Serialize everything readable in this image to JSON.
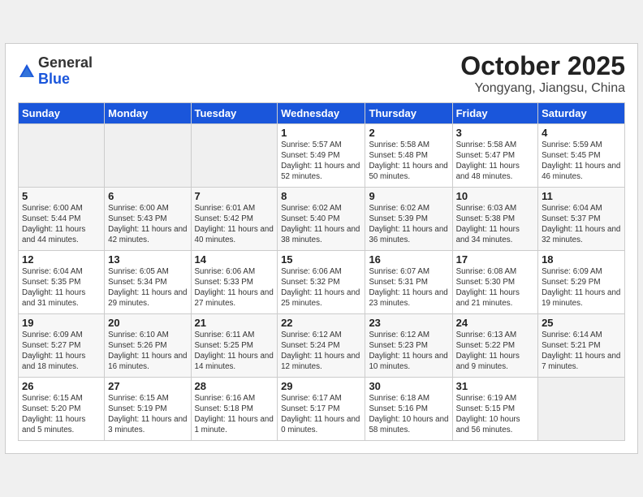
{
  "header": {
    "logo_general": "General",
    "logo_blue": "Blue",
    "title": "October 2025",
    "subtitle": "Yongyang, Jiangsu, China"
  },
  "weekdays": [
    "Sunday",
    "Monday",
    "Tuesday",
    "Wednesday",
    "Thursday",
    "Friday",
    "Saturday"
  ],
  "weeks": [
    [
      {
        "day": "",
        "info": ""
      },
      {
        "day": "",
        "info": ""
      },
      {
        "day": "",
        "info": ""
      },
      {
        "day": "1",
        "info": "Sunrise: 5:57 AM\nSunset: 5:49 PM\nDaylight: 11 hours and 52 minutes."
      },
      {
        "day": "2",
        "info": "Sunrise: 5:58 AM\nSunset: 5:48 PM\nDaylight: 11 hours and 50 minutes."
      },
      {
        "day": "3",
        "info": "Sunrise: 5:58 AM\nSunset: 5:47 PM\nDaylight: 11 hours and 48 minutes."
      },
      {
        "day": "4",
        "info": "Sunrise: 5:59 AM\nSunset: 5:45 PM\nDaylight: 11 hours and 46 minutes."
      }
    ],
    [
      {
        "day": "5",
        "info": "Sunrise: 6:00 AM\nSunset: 5:44 PM\nDaylight: 11 hours and 44 minutes."
      },
      {
        "day": "6",
        "info": "Sunrise: 6:00 AM\nSunset: 5:43 PM\nDaylight: 11 hours and 42 minutes."
      },
      {
        "day": "7",
        "info": "Sunrise: 6:01 AM\nSunset: 5:42 PM\nDaylight: 11 hours and 40 minutes."
      },
      {
        "day": "8",
        "info": "Sunrise: 6:02 AM\nSunset: 5:40 PM\nDaylight: 11 hours and 38 minutes."
      },
      {
        "day": "9",
        "info": "Sunrise: 6:02 AM\nSunset: 5:39 PM\nDaylight: 11 hours and 36 minutes."
      },
      {
        "day": "10",
        "info": "Sunrise: 6:03 AM\nSunset: 5:38 PM\nDaylight: 11 hours and 34 minutes."
      },
      {
        "day": "11",
        "info": "Sunrise: 6:04 AM\nSunset: 5:37 PM\nDaylight: 11 hours and 32 minutes."
      }
    ],
    [
      {
        "day": "12",
        "info": "Sunrise: 6:04 AM\nSunset: 5:35 PM\nDaylight: 11 hours and 31 minutes."
      },
      {
        "day": "13",
        "info": "Sunrise: 6:05 AM\nSunset: 5:34 PM\nDaylight: 11 hours and 29 minutes."
      },
      {
        "day": "14",
        "info": "Sunrise: 6:06 AM\nSunset: 5:33 PM\nDaylight: 11 hours and 27 minutes."
      },
      {
        "day": "15",
        "info": "Sunrise: 6:06 AM\nSunset: 5:32 PM\nDaylight: 11 hours and 25 minutes."
      },
      {
        "day": "16",
        "info": "Sunrise: 6:07 AM\nSunset: 5:31 PM\nDaylight: 11 hours and 23 minutes."
      },
      {
        "day": "17",
        "info": "Sunrise: 6:08 AM\nSunset: 5:30 PM\nDaylight: 11 hours and 21 minutes."
      },
      {
        "day": "18",
        "info": "Sunrise: 6:09 AM\nSunset: 5:29 PM\nDaylight: 11 hours and 19 minutes."
      }
    ],
    [
      {
        "day": "19",
        "info": "Sunrise: 6:09 AM\nSunset: 5:27 PM\nDaylight: 11 hours and 18 minutes."
      },
      {
        "day": "20",
        "info": "Sunrise: 6:10 AM\nSunset: 5:26 PM\nDaylight: 11 hours and 16 minutes."
      },
      {
        "day": "21",
        "info": "Sunrise: 6:11 AM\nSunset: 5:25 PM\nDaylight: 11 hours and 14 minutes."
      },
      {
        "day": "22",
        "info": "Sunrise: 6:12 AM\nSunset: 5:24 PM\nDaylight: 11 hours and 12 minutes."
      },
      {
        "day": "23",
        "info": "Sunrise: 6:12 AM\nSunset: 5:23 PM\nDaylight: 11 hours and 10 minutes."
      },
      {
        "day": "24",
        "info": "Sunrise: 6:13 AM\nSunset: 5:22 PM\nDaylight: 11 hours and 9 minutes."
      },
      {
        "day": "25",
        "info": "Sunrise: 6:14 AM\nSunset: 5:21 PM\nDaylight: 11 hours and 7 minutes."
      }
    ],
    [
      {
        "day": "26",
        "info": "Sunrise: 6:15 AM\nSunset: 5:20 PM\nDaylight: 11 hours and 5 minutes."
      },
      {
        "day": "27",
        "info": "Sunrise: 6:15 AM\nSunset: 5:19 PM\nDaylight: 11 hours and 3 minutes."
      },
      {
        "day": "28",
        "info": "Sunrise: 6:16 AM\nSunset: 5:18 PM\nDaylight: 11 hours and 1 minute."
      },
      {
        "day": "29",
        "info": "Sunrise: 6:17 AM\nSunset: 5:17 PM\nDaylight: 11 hours and 0 minutes."
      },
      {
        "day": "30",
        "info": "Sunrise: 6:18 AM\nSunset: 5:16 PM\nDaylight: 10 hours and 58 minutes."
      },
      {
        "day": "31",
        "info": "Sunrise: 6:19 AM\nSunset: 5:15 PM\nDaylight: 10 hours and 56 minutes."
      },
      {
        "day": "",
        "info": ""
      }
    ]
  ]
}
